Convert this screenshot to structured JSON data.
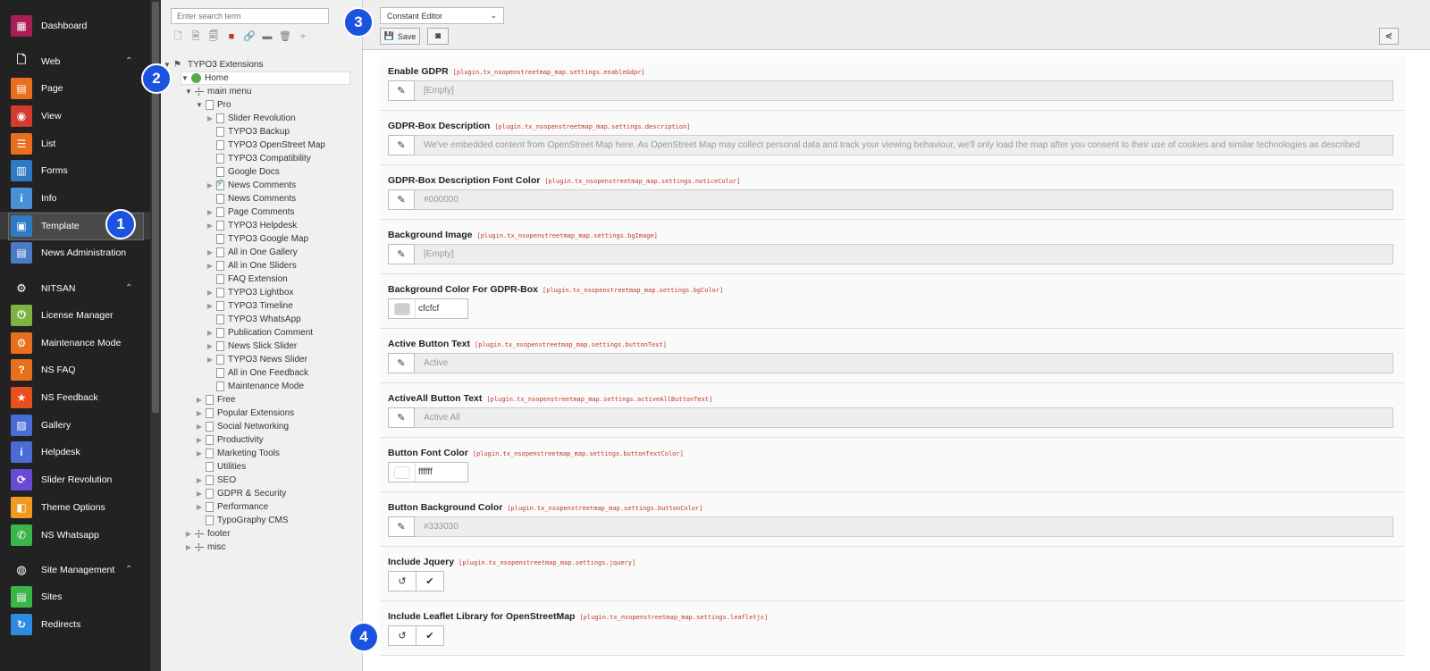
{
  "sidebar": {
    "items": [
      {
        "label": "Dashboard",
        "icon": "dashboard-icon",
        "color": "#a71f55",
        "type": "module"
      },
      {
        "label": "Web",
        "icon": "file-icon",
        "type": "group"
      },
      {
        "label": "Page",
        "icon": "page-icon",
        "color": "#e8701d",
        "type": "module"
      },
      {
        "label": "View",
        "icon": "eye-icon",
        "color": "#d23b2e",
        "type": "module"
      },
      {
        "label": "List",
        "icon": "list-icon",
        "color": "#e8701d",
        "type": "module"
      },
      {
        "label": "Forms",
        "icon": "forms-icon",
        "color": "#2e7bc4",
        "type": "module"
      },
      {
        "label": "Info",
        "icon": "info-icon",
        "color": "#4a90d9",
        "type": "module"
      },
      {
        "label": "Template",
        "icon": "template-icon",
        "color": "#2e7bc4",
        "type": "module",
        "active": true
      },
      {
        "label": "News Administration",
        "icon": "news-icon",
        "color": "#4a7bc4",
        "type": "module"
      },
      {
        "label": "NITSAN",
        "icon": "gear-icon",
        "type": "group"
      },
      {
        "label": "License Manager",
        "icon": "power-icon",
        "color": "#7cb342",
        "type": "module"
      },
      {
        "label": "Maintenance Mode",
        "icon": "maintenance-icon",
        "color": "#e8701d",
        "type": "module"
      },
      {
        "label": "NS FAQ",
        "icon": "faq-icon",
        "color": "#e8701d",
        "type": "module"
      },
      {
        "label": "NS Feedback",
        "icon": "star-icon",
        "color": "#e8501d",
        "type": "module"
      },
      {
        "label": "Gallery",
        "icon": "gallery-icon",
        "color": "#4a6cd4",
        "type": "module"
      },
      {
        "label": "Helpdesk",
        "icon": "helpdesk-icon",
        "color": "#4a6cd4",
        "type": "module"
      },
      {
        "label": "Slider Revolution",
        "icon": "slider-icon",
        "color": "#6a4ad4",
        "type": "module"
      },
      {
        "label": "Theme Options",
        "icon": "theme-icon",
        "color": "#f09a20",
        "type": "module"
      },
      {
        "label": "NS Whatsapp",
        "icon": "whatsapp-icon",
        "color": "#3bb54a",
        "type": "module"
      },
      {
        "label": "Site Management",
        "icon": "globe-icon",
        "type": "group"
      },
      {
        "label": "Sites",
        "icon": "sites-icon",
        "color": "#3bb54a",
        "type": "module"
      },
      {
        "label": "Redirects",
        "icon": "redirect-icon",
        "color": "#2e8ce0",
        "type": "module"
      }
    ]
  },
  "tree": {
    "search_placeholder": "Enter search term",
    "nodes": [
      {
        "label": "TYPO3 Extensions",
        "kind": "root",
        "level": 0,
        "toggle": "open"
      },
      {
        "label": "Home",
        "kind": "globe",
        "level": 1,
        "toggle": "open"
      },
      {
        "label": "main menu",
        "kind": "sep",
        "level": 2,
        "toggle": "open"
      },
      {
        "label": "Pro",
        "kind": "page",
        "level": 3,
        "toggle": "open"
      },
      {
        "label": "Slider Revolution",
        "kind": "page",
        "level": 4,
        "toggle": "closed"
      },
      {
        "label": "TYPO3 Backup",
        "kind": "page",
        "level": 4,
        "toggle": ""
      },
      {
        "label": "TYPO3 OpenStreet Map",
        "kind": "page",
        "level": 4,
        "toggle": ""
      },
      {
        "label": "TYPO3 Compatibility",
        "kind": "page",
        "level": 4,
        "toggle": ""
      },
      {
        "label": "Google Docs",
        "kind": "page",
        "level": 4,
        "toggle": ""
      },
      {
        "label": "News Comments",
        "kind": "link",
        "level": 4,
        "toggle": "closed"
      },
      {
        "label": "News Comments",
        "kind": "page",
        "level": 4,
        "toggle": ""
      },
      {
        "label": "Page Comments",
        "kind": "page",
        "level": 4,
        "toggle": "closed"
      },
      {
        "label": "TYPO3 Helpdesk",
        "kind": "page",
        "level": 4,
        "toggle": "closed"
      },
      {
        "label": "TYPO3 Google Map",
        "kind": "page",
        "level": 4,
        "toggle": ""
      },
      {
        "label": "All in One Gallery",
        "kind": "page",
        "level": 4,
        "toggle": "closed"
      },
      {
        "label": "All in One Sliders",
        "kind": "page",
        "level": 4,
        "toggle": "closed"
      },
      {
        "label": "FAQ Extension",
        "kind": "page",
        "level": 4,
        "toggle": ""
      },
      {
        "label": "TYPO3 Lightbox",
        "kind": "page",
        "level": 4,
        "toggle": "closed"
      },
      {
        "label": "TYPO3 Timeline",
        "kind": "page",
        "level": 4,
        "toggle": "closed"
      },
      {
        "label": "TYPO3 WhatsApp",
        "kind": "page",
        "level": 4,
        "toggle": ""
      },
      {
        "label": "Publication Comment",
        "kind": "page",
        "level": 4,
        "toggle": "closed"
      },
      {
        "label": "News Slick Slider",
        "kind": "page",
        "level": 4,
        "toggle": "closed"
      },
      {
        "label": "TYPO3 News Slider",
        "kind": "page",
        "level": 4,
        "toggle": "closed"
      },
      {
        "label": "All in One Feedback",
        "kind": "page",
        "level": 4,
        "toggle": ""
      },
      {
        "label": "Maintenance Mode",
        "kind": "page",
        "level": 4,
        "toggle": ""
      },
      {
        "label": "Free",
        "kind": "page",
        "level": 3,
        "toggle": "closed"
      },
      {
        "label": "Popular Extensions",
        "kind": "page",
        "level": 3,
        "toggle": "closed"
      },
      {
        "label": "Social Networking",
        "kind": "page",
        "level": 3,
        "toggle": "closed"
      },
      {
        "label": "Productivity",
        "kind": "page",
        "level": 3,
        "toggle": "closed"
      },
      {
        "label": "Marketing Tools",
        "kind": "page",
        "level": 3,
        "toggle": "closed"
      },
      {
        "label": "Utilities",
        "kind": "page",
        "level": 3,
        "toggle": ""
      },
      {
        "label": "SEO",
        "kind": "page",
        "level": 3,
        "toggle": "closed"
      },
      {
        "label": "GDPR & Security",
        "kind": "page",
        "level": 3,
        "toggle": "closed"
      },
      {
        "label": "Performance",
        "kind": "page",
        "level": 3,
        "toggle": "closed"
      },
      {
        "label": "TypoGraphy CMS",
        "kind": "page",
        "level": 3,
        "toggle": ""
      },
      {
        "label": "footer",
        "kind": "sep",
        "level": 2,
        "toggle": "closed"
      },
      {
        "label": "misc",
        "kind": "sep",
        "level": 2,
        "toggle": "closed"
      }
    ]
  },
  "docbar": {
    "mode": "Constant Editor",
    "save_label": "Save"
  },
  "fields": [
    {
      "title": "Enable GDPR",
      "key": "[plugin.tx_nsopenstreetmap_map.settings.enableGdpr]",
      "type": "text",
      "value": "[Empty]"
    },
    {
      "title": "GDPR-Box Description",
      "key": "[plugin.tx_nsopenstreetmap_map.settings.description]",
      "type": "text",
      "value": "We've embedded content from OpenStreet Map here. As OpenStreet Map may collect personal data and track your viewing behaviour, we'll only load the map after you consent to their use of cookies and similar technologies as described"
    },
    {
      "title": "GDPR-Box Description Font Color",
      "key": "[plugin.tx_nsopenstreetmap_map.settings.noticeColor]",
      "type": "text",
      "value": "#000000"
    },
    {
      "title": "Background Image",
      "key": "[plugin.tx_nsopenstreetmap_map.settings.bgImage]",
      "type": "text",
      "value": "[Empty]"
    },
    {
      "title": "Background Color For GDPR-Box",
      "key": "[plugin.tx_nsopenstreetmap_map.settings.bgColor]",
      "type": "color",
      "value": "cfcfcf",
      "swatch": "#cfcfcf"
    },
    {
      "title": "Active Button Text",
      "key": "[plugin.tx_nsopenstreetmap_map.settings.buttonText]",
      "type": "text",
      "value": "Active"
    },
    {
      "title": "ActiveAll Button Text",
      "key": "[plugin.tx_nsopenstreetmap_map.settings.activeAllButtonText]",
      "type": "text",
      "value": "Active All"
    },
    {
      "title": "Button Font Color",
      "key": "[plugin.tx_nsopenstreetmap_map.settings.buttonTextColor]",
      "type": "color",
      "value": "ffffff",
      "swatch": "#ffffff"
    },
    {
      "title": "Button Background Color",
      "key": "[plugin.tx_nsopenstreetmap_map.settings.buttonColor]",
      "type": "text",
      "value": "#333030"
    },
    {
      "title": "Include Jquery",
      "key": "[plugin.tx_nsopenstreetmap_map.settings.jquery]",
      "type": "bool"
    },
    {
      "title": "Include Leaflet Library for OpenStreetMap",
      "key": "[plugin.tx_nsopenstreetmap_map.settings.leafletjs]",
      "type": "bool"
    }
  ],
  "badges": [
    "1",
    "2",
    "3",
    "4"
  ],
  "colors": {
    "badge": "#1a53e0",
    "sidebar_bg": "#222222",
    "key_text": "#c0392b"
  }
}
